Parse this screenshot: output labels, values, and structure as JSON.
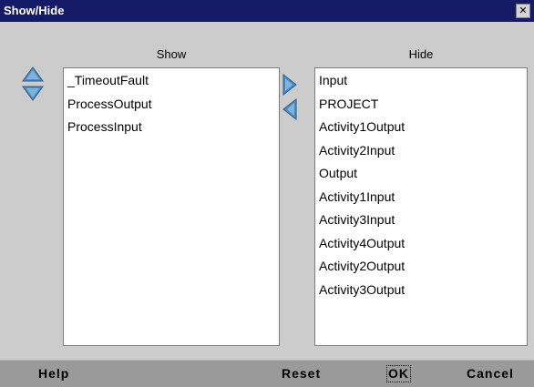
{
  "window": {
    "title": "Show/Hide",
    "close_glyph": "✕"
  },
  "show_panel": {
    "header": "Show",
    "items": [
      "_TimeoutFault",
      "ProcessOutput",
      "ProcessInput"
    ]
  },
  "hide_panel": {
    "header": "Hide",
    "items": [
      "Input",
      "PROJECT",
      "Activity1Output",
      "Activity2Input",
      "Output",
      "Activity1Input",
      "Activity3Input",
      "Activity4Output",
      "Activity2Output",
      "Activity3Output"
    ]
  },
  "controls": {
    "move_up_icon": "triangle-up",
    "move_down_icon": "triangle-down",
    "hide_selected_icon": "triangle-right",
    "show_selected_icon": "triangle-left",
    "arrow_color": "#4f8ec2"
  },
  "buttons": {
    "help": "Help",
    "reset": "Reset",
    "ok": "OK",
    "cancel": "Cancel"
  },
  "colors": {
    "titlebar": "#151a67",
    "dialog_bg": "#cccccc",
    "button_bar": "#9a9a9a"
  }
}
